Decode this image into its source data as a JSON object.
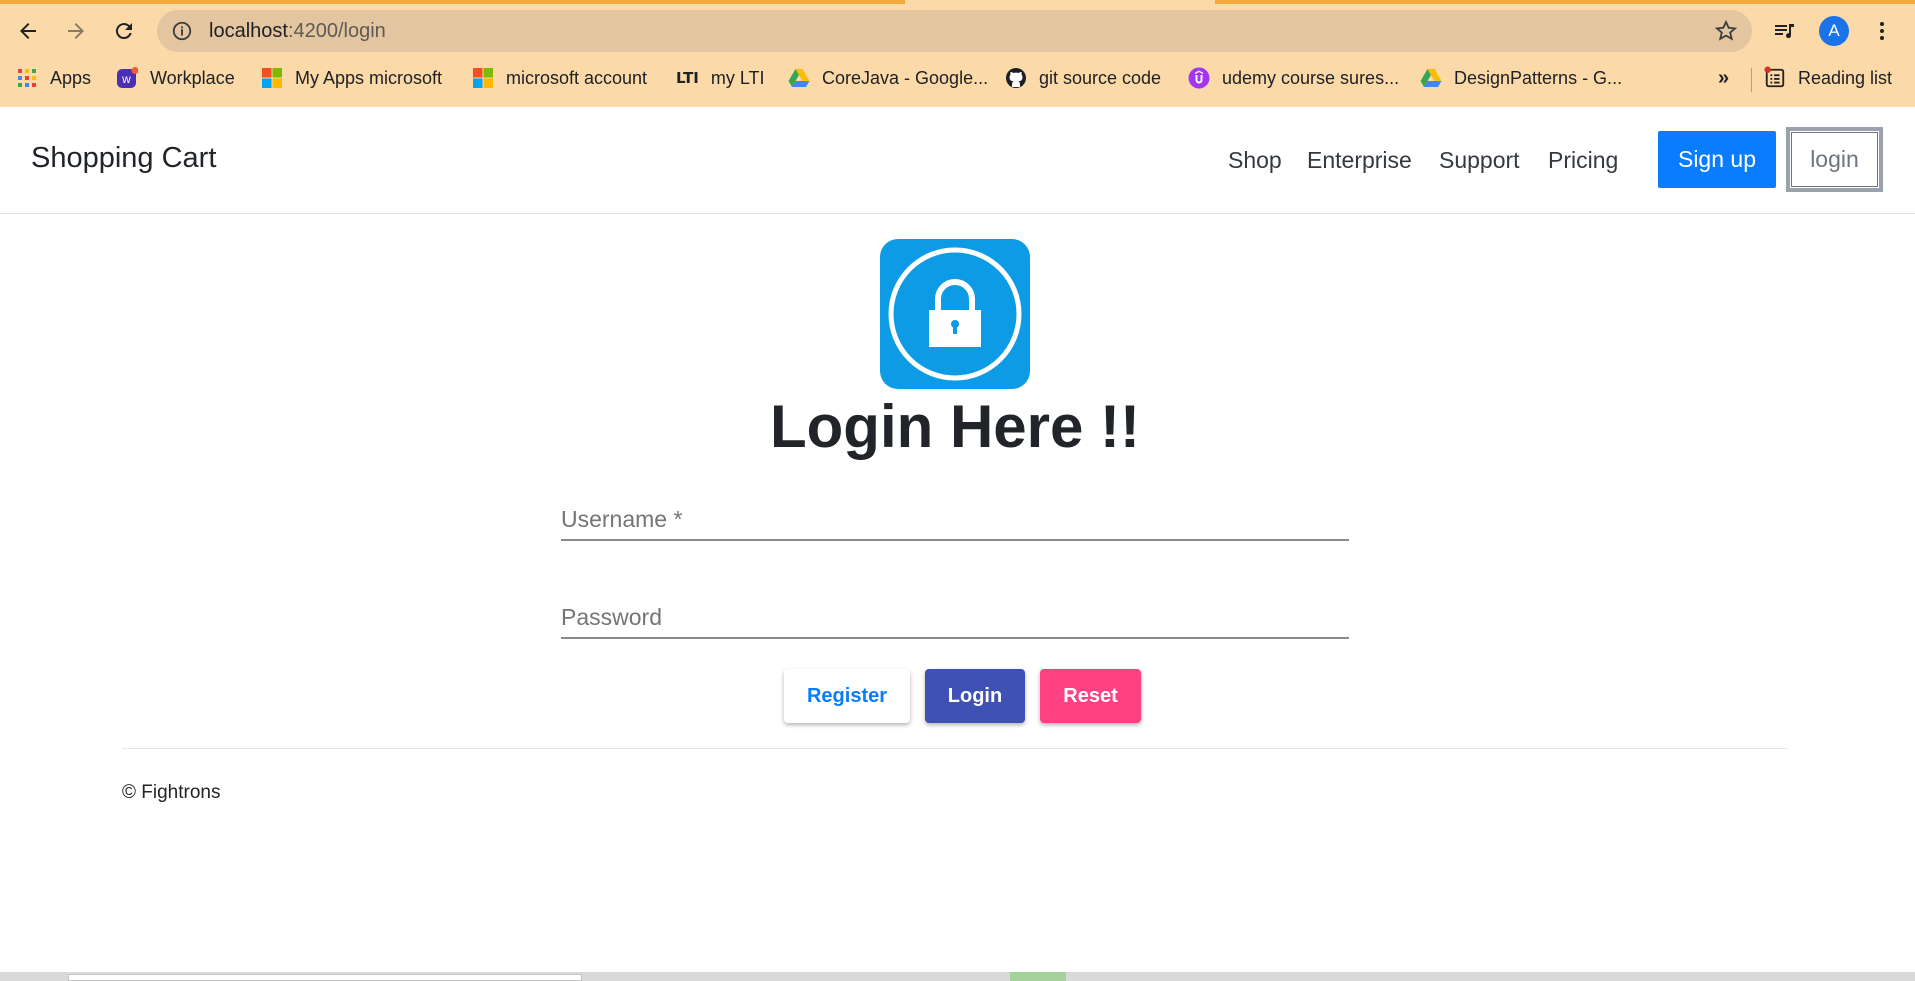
{
  "browser": {
    "url_host": "localhost",
    "url_rest": ":4200/login",
    "avatar_letter": "A",
    "bookmarks": [
      {
        "label": "Apps",
        "icon": "apps-grid-icon"
      },
      {
        "label": "Workplace",
        "icon": "workplace-icon"
      },
      {
        "label": "My Apps microsoft",
        "icon": "microsoft-logo-icon"
      },
      {
        "label": "microsoft account",
        "icon": "microsoft-logo-icon"
      },
      {
        "label": "my LTI",
        "icon": "lti-icon",
        "icon_text": "LTI"
      },
      {
        "label": "CoreJava - Google...",
        "icon": "google-drive-icon"
      },
      {
        "label": "git source code",
        "icon": "github-icon"
      },
      {
        "label": "udemy course sures...",
        "icon": "udemy-icon"
      },
      {
        "label": "DesignPatterns - G...",
        "icon": "google-drive-icon"
      }
    ],
    "overflow_label": "»",
    "reading_list_label": "Reading list"
  },
  "navbar": {
    "brand": "Shopping Cart",
    "links": [
      "Shop",
      "Enterprise",
      "Support",
      "Pricing"
    ],
    "signup_label": "Sign up",
    "login_label": "login"
  },
  "main": {
    "logo_icon": "lock-icon",
    "title": "Login Here !!",
    "username_placeholder": "Username *",
    "password_placeholder": "Password",
    "register_label": "Register",
    "login_label": "Login",
    "reset_label": "Reset"
  },
  "footer": {
    "copyright": "© Fightrons"
  },
  "colors": {
    "browser_chrome": "#fbd9a8",
    "primary": "#0a7cff",
    "login_btn": "#3f51b5",
    "reset_btn": "#ff4081",
    "lock_bg": "#0d9be6"
  }
}
